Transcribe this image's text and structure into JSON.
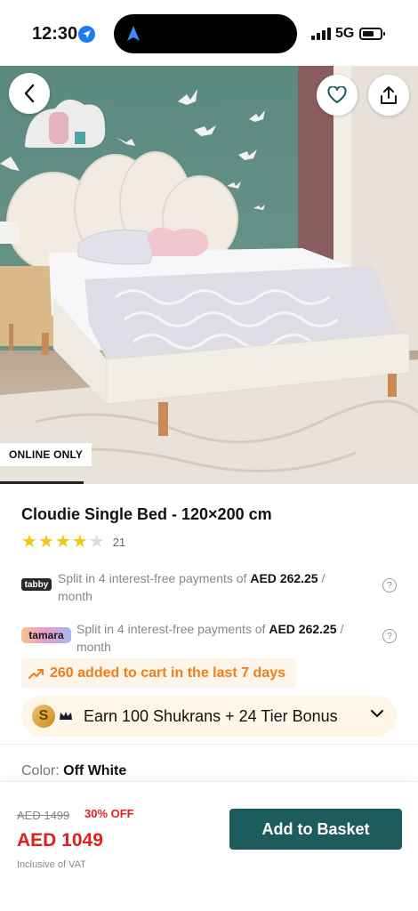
{
  "status_bar": {
    "time": "12:30",
    "network": "5G",
    "icons": [
      "location-arrow-icon",
      "navigation-arrow-icon",
      "signal-icon",
      "battery-icon"
    ]
  },
  "hero": {
    "badge": "ONLINE ONLY",
    "icons": [
      "back-chevron-icon",
      "heart-icon",
      "share-icon"
    ]
  },
  "product": {
    "title": "Cloudie Single Bed - 120×200 cm",
    "rating_value": 4,
    "rating_max": 5,
    "rating_count": "21"
  },
  "payments": [
    {
      "provider": "tabby",
      "text_before": "Split in 4 interest-free payments of",
      "amount": "AED 262.25",
      "text_after": " /",
      "line2": "month",
      "info": "?"
    },
    {
      "provider": "tamara",
      "text_before": "Split in 4 interest-free payments of",
      "amount": "AED 262.25",
      "text_after": " /",
      "line2": "month",
      "info": "?"
    }
  ],
  "trend": {
    "text": "260 added to cart in the last 7 days",
    "color": "#ef7d1c"
  },
  "shukran": {
    "coin": "S",
    "text": "Earn 100 Shukrans + 24 Tier Bonus"
  },
  "color": {
    "label": "Color:",
    "value": "Off White"
  },
  "pricing": {
    "old_price": "AED 1499",
    "discount": "30% OFF",
    "price": "AED 1049",
    "vat_note": "Inclusive of VAT",
    "price_color": "#e02020"
  },
  "basket_button": {
    "label": "Add to Basket",
    "color": "#1d5c5c"
  }
}
